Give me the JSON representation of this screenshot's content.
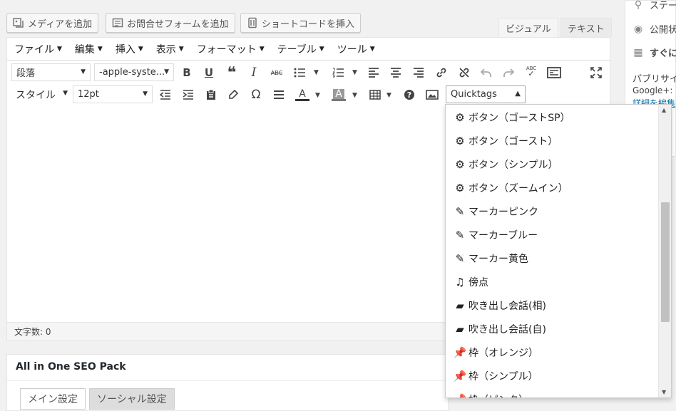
{
  "media_buttons": [
    {
      "label": "メディアを追加",
      "icon": "media-icon"
    },
    {
      "label": "お問合せフォームを追加",
      "icon": "form-icon"
    },
    {
      "label": "ショートコードを挿入",
      "icon": "shortcode-icon"
    }
  ],
  "editor_tabs": {
    "visual": "ビジュアル",
    "text": "テキスト"
  },
  "menubar": [
    "ファイル",
    "編集",
    "挿入",
    "表示",
    "フォーマット",
    "テーブル",
    "ツール"
  ],
  "toolbar": {
    "format_select": "段落",
    "font_select": "-apple-syste...",
    "style_select": "スタイル",
    "size_select": "12pt",
    "quicktags_select": "Quicktags",
    "icons_row1": [
      "B",
      "U",
      "❝",
      "I",
      "ABC",
      "list-icon",
      "ordered-list-icon",
      "align-left-icon",
      "align-center-icon",
      "align-right-icon",
      "link-icon",
      "unlink-icon",
      "undo-icon",
      "redo-icon",
      "spellcheck-icon",
      "toolbar-toggle-icon",
      "fullscreen-icon"
    ]
  },
  "word_count": "文字数: 0",
  "quicktags_menu": [
    {
      "icon": "gear-icon",
      "glyph": "⚙",
      "label": "ボタン（ゴーストSP）"
    },
    {
      "icon": "gear-icon",
      "glyph": "⚙",
      "label": "ボタン（ゴースト）"
    },
    {
      "icon": "gear-icon",
      "glyph": "⚙",
      "label": "ボタン（シンプル）"
    },
    {
      "icon": "gear-icon",
      "glyph": "⚙",
      "label": "ボタン（ズームイン）"
    },
    {
      "icon": "marker-icon",
      "glyph": "✎",
      "label": "マーカーピンク"
    },
    {
      "icon": "marker-icon",
      "glyph": "✎",
      "label": "マーカーブルー"
    },
    {
      "icon": "marker-icon",
      "glyph": "✎",
      "label": "マーカー黄色"
    },
    {
      "icon": "music-note-icon",
      "glyph": "♫",
      "label": "傍点"
    },
    {
      "icon": "speech-bubble-icon",
      "glyph": "▰",
      "label": "吹き出し会話(相)"
    },
    {
      "icon": "speech-bubble-icon",
      "glyph": "▰",
      "label": "吹き出し会話(自)"
    },
    {
      "icon": "pin-icon",
      "glyph": "📌",
      "label": "枠（オレンジ）"
    },
    {
      "icon": "pin-icon",
      "glyph": "📌",
      "label": "枠（シンプル）"
    },
    {
      "icon": "pin-icon",
      "glyph": "📌",
      "label": "枠（ピンク）"
    }
  ],
  "seo_box": {
    "title": "All in One SEO Pack",
    "tabs": [
      "メイン設定",
      "ソーシャル設定"
    ]
  },
  "sidebar": {
    "rows": [
      "ステー",
      "公開状",
      "すぐに",
      "パブリサイ",
      "Google+: (",
      "詳細を編集"
    ]
  },
  "colors": {
    "accent": "#0073aa",
    "border": "#e5e5e5",
    "bg": "#f1f1f1"
  }
}
